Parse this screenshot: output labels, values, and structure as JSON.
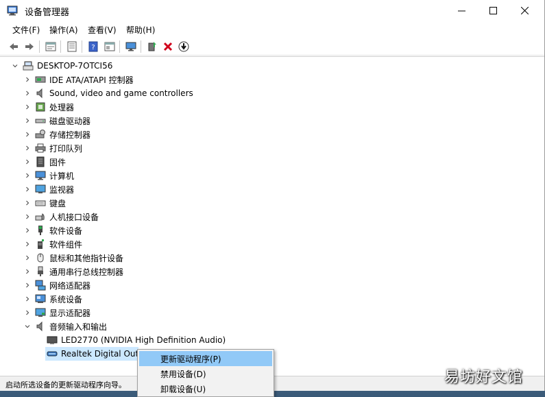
{
  "window": {
    "title": "设备管理器"
  },
  "menu": [
    "文件(F)",
    "操作(A)",
    "查看(V)",
    "帮助(H)"
  ],
  "toolbar": [
    "back-icon",
    "forward-icon",
    "properties-icon",
    "view-icon",
    "help-icon",
    "show-hidden-icon",
    "monitor-icon",
    "update-driver-icon",
    "uninstall-icon",
    "scan-icon"
  ],
  "tree": {
    "root": "DESKTOP-7OTCI56",
    "categories": [
      "IDE ATA/ATAPI 控制器",
      "Sound, video and game controllers",
      "处理器",
      "磁盘驱动器",
      "存储控制器",
      "打印队列",
      "固件",
      "计算机",
      "监视器",
      "键盘",
      "人机接口设备",
      "软件设备",
      "软件组件",
      "鼠标和其他指针设备",
      "通用串行总线控制器",
      "网络适配器",
      "系统设备",
      "显示适配器",
      "音频输入和输出"
    ],
    "audio_children": [
      "LED2770 (NVIDIA High Definition Audio)",
      "Realtek Digital Out"
    ]
  },
  "context_menu": [
    "更新驱动程序(P)",
    "禁用设备(D)",
    "卸载设备(U)"
  ],
  "status": "启动所选设备的更新驱动程序向导。",
  "watermark": "易坊好文馆",
  "colors": {
    "selection": "#cce8ff",
    "menu_hover": "#91c9f7",
    "accent": "#0078d7"
  }
}
